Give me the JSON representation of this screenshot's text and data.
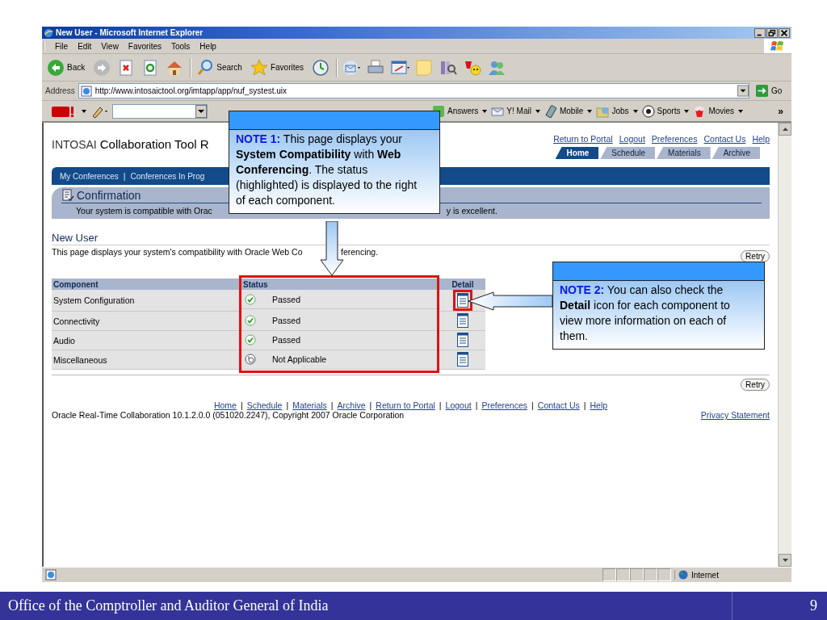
{
  "window": {
    "title": "New User - Microsoft Internet Explorer"
  },
  "menu": [
    "File",
    "Edit",
    "View",
    "Favorites",
    "Tools",
    "Help"
  ],
  "toolbar": [
    {
      "kind": "back",
      "label": "Back"
    },
    {
      "kind": "forward"
    },
    {
      "kind": "stop"
    },
    {
      "kind": "refresh"
    },
    {
      "kind": "home"
    },
    {
      "kind": "search",
      "label": "Search"
    },
    {
      "kind": "favorites",
      "label": "Favorites"
    },
    {
      "kind": "history"
    },
    {
      "kind": "mail"
    },
    {
      "kind": "print"
    },
    {
      "kind": "edit"
    },
    {
      "kind": "note"
    },
    {
      "kind": "research"
    },
    {
      "kind": "messenger"
    },
    {
      "kind": "people"
    }
  ],
  "address": {
    "label": "Address",
    "value": "http://www.intosaictool.org/imtapp/app/nuf_systest.uix",
    "go": "Go"
  },
  "yahoo_bar": {
    "items": [
      {
        "kind": "answers",
        "label": "Answers"
      },
      {
        "kind": "mail",
        "label": "Y! Mail"
      },
      {
        "kind": "mobile",
        "label": "Mobile"
      },
      {
        "kind": "jobs",
        "label": "Jobs"
      },
      {
        "kind": "sports",
        "label": "Sports"
      },
      {
        "kind": "movies",
        "label": "Movies"
      }
    ],
    "more": "»"
  },
  "page": {
    "brand": "INTOSAI",
    "title": "Collaboration Tool R",
    "global_links": [
      "Return to Portal",
      "Logout",
      "Preferences",
      "Contact Us",
      "Help"
    ],
    "tabs": [
      {
        "label": "Home",
        "selected": true
      },
      {
        "label": "Schedule",
        "selected": false
      },
      {
        "label": "Materials",
        "selected": false
      },
      {
        "label": "Archive",
        "selected": false
      }
    ],
    "nav": {
      "items": [
        "My Conferences",
        "Conferences In Prog"
      ],
      "separator": "|"
    },
    "confirmation": {
      "title": "Confirmation",
      "message_start": "Your system is compatible with Orac",
      "message_end": "y is excellent."
    },
    "heading": "New User",
    "description_start": "This page displays your system's compatibility with Oracle Web Co",
    "description_end": "ferencing.",
    "retry": "Retry",
    "table": {
      "columns": [
        "Component",
        "Status",
        "Detail"
      ],
      "rows": [
        {
          "component": "System Configuration",
          "kind": "passed",
          "status": "Passed",
          "detail_highlighted": true
        },
        {
          "component": "Connectivity",
          "kind": "passed",
          "status": "Passed",
          "detail_highlighted": false
        },
        {
          "component": "Audio",
          "kind": "passed",
          "status": "Passed",
          "detail_highlighted": false
        },
        {
          "component": "Miscellaneous",
          "kind": "na",
          "status": "Not Applicable",
          "detail_highlighted": false
        }
      ]
    },
    "retry_bottom": "Retry",
    "footer_links": [
      "Home",
      "Schedule",
      "Materials",
      "Archive",
      "Return to Portal",
      "Logout",
      "Preferences",
      "Contact Us",
      "Help"
    ],
    "copyright": "Oracle Real-Time Collaboration 10.1.2.0.0 (051020.2247), Copyright 2007 Oracle Corporation",
    "privacy": "Privacy Statement"
  },
  "status_bar": {
    "zone": "Internet"
  },
  "notes": [
    {
      "label": "NOTE 1:",
      "text": "This page displays your **System Compatibility** with **Web Conferencing**. The status (highlighted) is displayed to the right of each component."
    },
    {
      "label": "NOTE 2:",
      "text": "You can also check the **Detail** icon for each component to view more information on each of them."
    }
  ],
  "slide_footer": {
    "org": "Office of the Comptroller and Auditor General of India",
    "page": "9"
  }
}
